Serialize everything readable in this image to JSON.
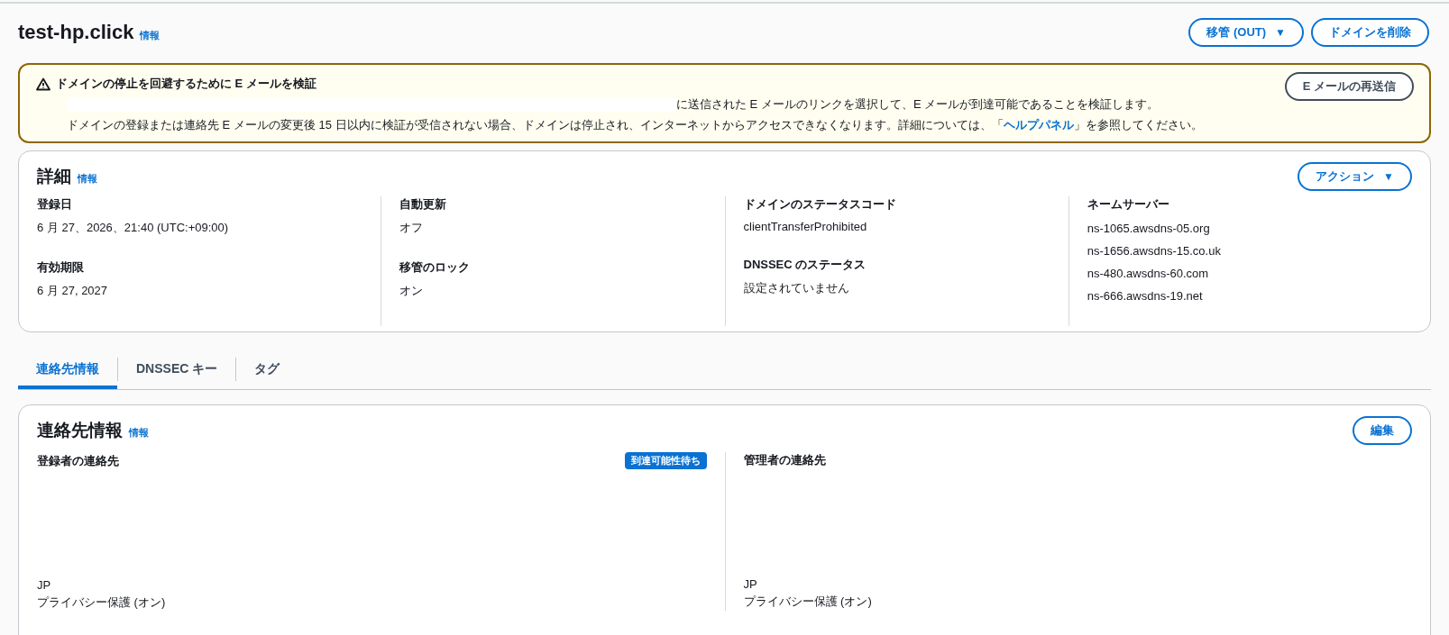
{
  "header": {
    "title": "test-hp.click",
    "info": "情報",
    "buttons": [
      {
        "label": "移管 (OUT)",
        "caret": "▼"
      },
      {
        "label": "ドメインを削除"
      }
    ]
  },
  "alert": {
    "title": "ドメインの停止を回避するために E メールを検証",
    "line1": "に送信された E メールのリンクを選択して、E メールが到達可能であることを検証します。",
    "line2_before": "ドメインの登録または連絡先 E メールの変更後 15 日以内に検証が受信されない場合、ドメインは停止され、インターネットからアクセスできなくなります。詳細については、「",
    "line2_link": "ヘルプパネル",
    "line2_after": "」を参照してください。",
    "button": "E メールの再送信"
  },
  "details": {
    "title": "詳細",
    "info": "情報",
    "button": {
      "label": "アクション",
      "caret": "▼"
    },
    "columns": [
      {
        "fields": [
          {
            "label": "登録日",
            "values": [
              "6 月 27、2026、21:40 (UTC:+09:00)"
            ]
          },
          {
            "label": "有効期限",
            "values": [
              "6 月 27, 2027"
            ]
          }
        ]
      },
      {
        "fields": [
          {
            "label": "自動更新",
            "values": [
              "オフ"
            ]
          },
          {
            "label": "移管のロック",
            "values": [
              "オン"
            ]
          }
        ]
      },
      {
        "fields": [
          {
            "label": "ドメインのステータスコード",
            "values": [
              "clientTransferProhibited"
            ]
          },
          {
            "label": "DNSSEC のステータス",
            "values": [
              "設定されていません"
            ]
          }
        ]
      },
      {
        "fields": [
          {
            "label": "ネームサーバー",
            "values": [
              "ns-1065.awsdns-05.org",
              "ns-1656.awsdns-15.co.uk",
              "ns-480.awsdns-60.com",
              "ns-666.awsdns-19.net"
            ]
          }
        ]
      }
    ]
  },
  "tabs": [
    {
      "label": "連絡先情報",
      "selected": true
    },
    {
      "label": "DNSSEC キー",
      "selected": false
    },
    {
      "label": "タグ",
      "selected": false
    }
  ],
  "contact": {
    "title": "連絡先情報",
    "info": "情報",
    "button": "編集",
    "columns": [
      {
        "heading": "登録者の連絡先",
        "badge": "到達可能性待ち",
        "lines": [
          "JP",
          "プライバシー保護 (オン)"
        ]
      },
      {
        "heading": "管理者の連絡先",
        "lines": [
          "JP",
          "プライバシー保護 (オン)"
        ]
      }
    ]
  }
}
